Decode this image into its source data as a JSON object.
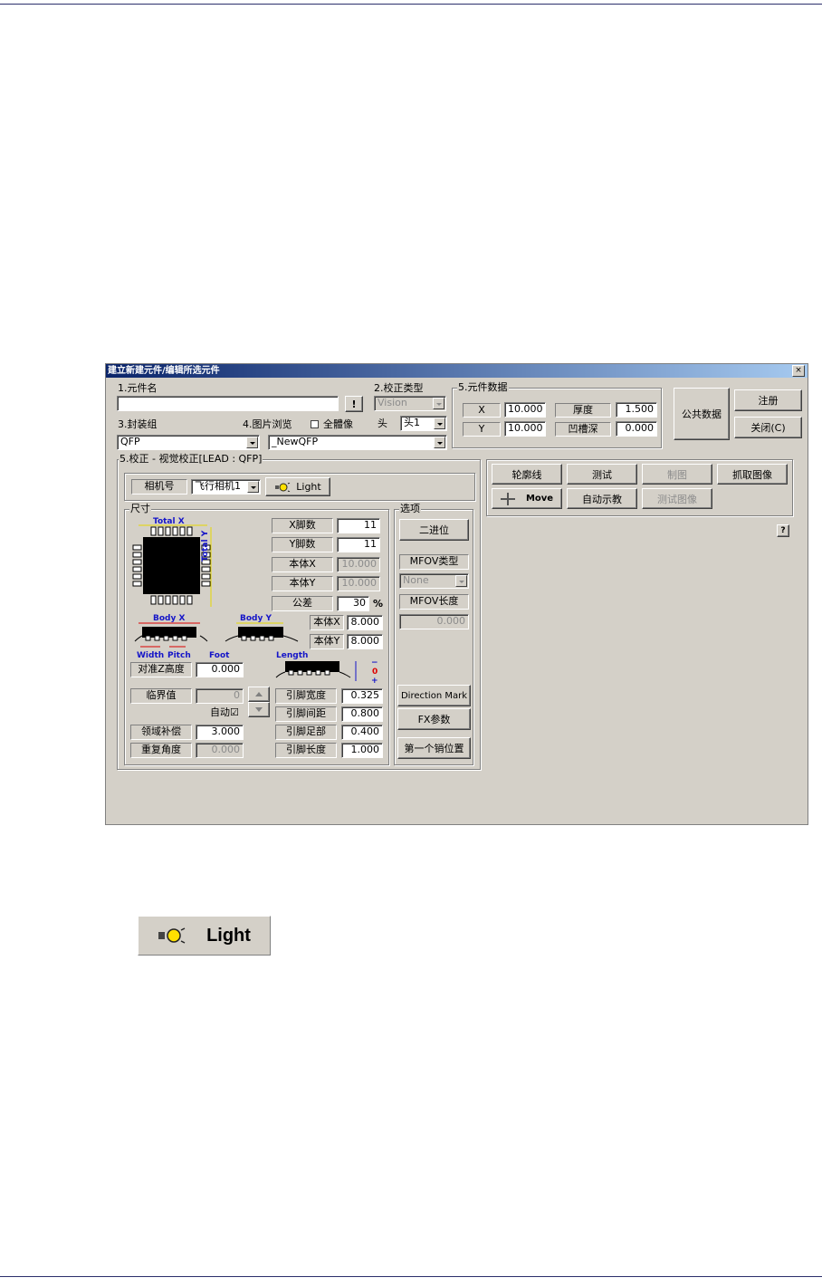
{
  "window": {
    "title": "建立新建元件/编辑所选元件",
    "close_glyph": "×"
  },
  "section1": {
    "label": "1.元件名",
    "name_value": "",
    "browse_label": "!"
  },
  "section2": {
    "label": "2.校正类型",
    "value": "Vision"
  },
  "section3": {
    "label": "3.封装组",
    "value": "QFP"
  },
  "section4": {
    "label": "4.图片浏览",
    "checkbox_label": "全體像",
    "head_label": "头",
    "head_value": "头1",
    "image_value": "_NewQFP"
  },
  "section5data": {
    "label": "5.元件数据",
    "x_label": "X",
    "x_value": "10.000",
    "y_label": "Y",
    "y_value": "10.000",
    "thickness_label": "厚度",
    "thickness_value": "1.500",
    "depth_label": "凹槽深",
    "depth_value": "0.000"
  },
  "right_buttons": {
    "common_data": "公共数据",
    "register": "注册",
    "close": "关闭(C)"
  },
  "calib": {
    "title": "5.校正 - 视觉校正[LEAD : QFP]",
    "camera_label": "相机号",
    "camera_value": "飞行相机1",
    "light_label": "Light"
  },
  "size": {
    "title": "尺寸",
    "total_x": "Total X",
    "total_y": "Total Y",
    "body_x": "Body X",
    "body_y": "Body Y",
    "width": "Width",
    "pitch": "Pitch",
    "foot": "Foot",
    "length": "Length",
    "x_pins_label": "X脚数",
    "x_pins_value": "11",
    "y_pins_label": "Y脚数",
    "y_pins_value": "11",
    "bodyx_label": "本体X",
    "bodyx_value": "10.000",
    "bodyy_label": "本体Y",
    "bodyy_value": "10.000",
    "tol_label": "公差",
    "tol_value": "30",
    "tol_unit": "%",
    "bodyx2_label": "本体X",
    "bodyx2_value": "8.000",
    "bodyy2_label": "本体Y",
    "bodyy2_value": "8.000",
    "align_z_label": "对准Z高度",
    "align_z_value": "0.000",
    "threshold_label": "临界值",
    "threshold_value": "0",
    "auto_label": "自动☑",
    "comp_label": "领域补偿",
    "comp_value": "3.000",
    "repeat_label": "重复角度",
    "repeat_value": "0.000",
    "lead_width_label": "引脚宽度",
    "lead_width_value": "0.325",
    "lead_pitch_label": "引脚间距",
    "lead_pitch_value": "0.800",
    "lead_foot_label": "引脚足部",
    "lead_foot_value": "0.400",
    "lead_length_label": "引脚长度",
    "lead_length_value": "1.000",
    "minus": "−",
    "zero": "0",
    "plus": "+"
  },
  "options": {
    "title": "选项",
    "binarize": "二进位",
    "mfov_type_label": "MFOV类型",
    "mfov_type_value": "None",
    "mfov_len_label": "MFOV长度",
    "mfov_len_value": "0.000",
    "direction_mark": "Direction Mark",
    "fx_params": "FX参数",
    "first_pin": "第一个销位置"
  },
  "toolbar": {
    "contour": "轮廓线",
    "test": "测试",
    "draw": "制图",
    "grab": "抓取图像",
    "move": "Move",
    "auto_teach": "自动示教",
    "test_image": "测试图像",
    "help": "?"
  },
  "sample_button": {
    "label": "Light"
  }
}
